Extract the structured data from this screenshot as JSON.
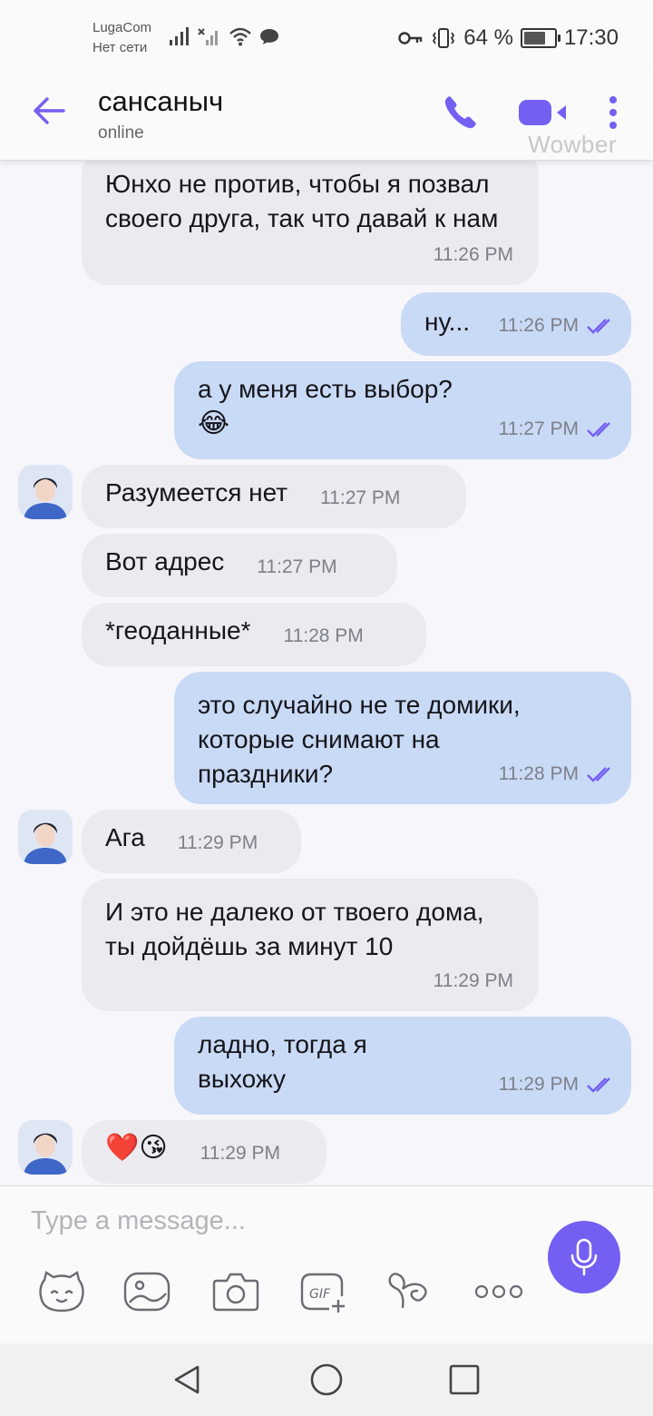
{
  "status_bar": {
    "carrier": "LugaCom",
    "network": "Нет сети",
    "battery": "64 %",
    "battery_level": 0.64,
    "time": "17:30"
  },
  "header": {
    "title": "сансаныч",
    "subtitle": "online",
    "watermark": "Wowber"
  },
  "messages": [
    {
      "dir": "in",
      "text": "Юнхо не против, чтобы я позвал своего друга, так что давай к нам",
      "time": "11:26 PM"
    },
    {
      "dir": "out",
      "text": "ну...",
      "time": "11:26 PM"
    },
    {
      "dir": "out",
      "text": "а у меня есть выбор?",
      "emoji": "😂",
      "time": "11:27 PM"
    },
    {
      "dir": "in",
      "text": "Разумеется нет",
      "time": "11:27 PM"
    },
    {
      "dir": "in",
      "text": "Вот адрес",
      "time": "11:27 PM"
    },
    {
      "dir": "in",
      "text": "*геоданные*",
      "time": "11:28 PM"
    },
    {
      "dir": "out",
      "text": "это случайно не те домики, которые снимают на праздники?",
      "time": "11:28 PM"
    },
    {
      "dir": "in",
      "text": "Ага",
      "time": "11:29 PM"
    },
    {
      "dir": "in",
      "text": "И это не далеко от твоего дома, ты дойдёшь за минут 10",
      "time": "11:29 PM"
    },
    {
      "dir": "out",
      "text": "ладно, тогда я выхожу",
      "time": "11:29 PM"
    },
    {
      "dir": "in",
      "text": "❤️😘",
      "time": "11:29 PM"
    }
  ],
  "composer": {
    "placeholder": "Type a message..."
  },
  "icons": {
    "back": "back-arrow-icon",
    "call": "phone-icon",
    "video": "video-camera-icon",
    "more": "more-vertical-icon",
    "sticker": "sticker-face-icon",
    "gallery": "gallery-icon",
    "camera": "camera-icon",
    "gif": "gif-icon",
    "doodle": "doodle-icon",
    "more_tools": "more-horizontal-icon",
    "mic": "microphone-icon"
  },
  "colors": {
    "accent": "#7360f2",
    "outgoing_bubble": "#c9daf6",
    "incoming_bubble": "#ebeaee",
    "read_ticks": "#7360f2"
  }
}
